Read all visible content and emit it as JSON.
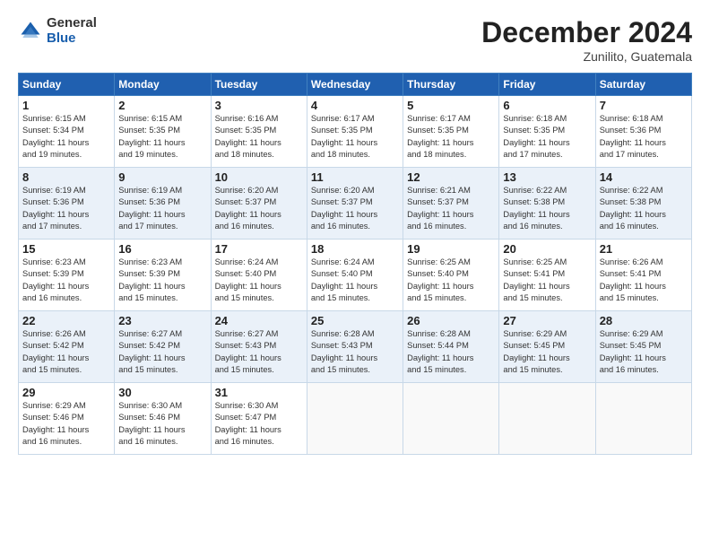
{
  "logo": {
    "general": "General",
    "blue": "Blue"
  },
  "header": {
    "month": "December 2024",
    "location": "Zunilito, Guatemala"
  },
  "weekdays": [
    "Sunday",
    "Monday",
    "Tuesday",
    "Wednesday",
    "Thursday",
    "Friday",
    "Saturday"
  ],
  "weeks": [
    [
      {
        "day": "1",
        "text": "Sunrise: 6:15 AM\nSunset: 5:34 PM\nDaylight: 11 hours\nand 19 minutes."
      },
      {
        "day": "2",
        "text": "Sunrise: 6:15 AM\nSunset: 5:35 PM\nDaylight: 11 hours\nand 19 minutes."
      },
      {
        "day": "3",
        "text": "Sunrise: 6:16 AM\nSunset: 5:35 PM\nDaylight: 11 hours\nand 18 minutes."
      },
      {
        "day": "4",
        "text": "Sunrise: 6:17 AM\nSunset: 5:35 PM\nDaylight: 11 hours\nand 18 minutes."
      },
      {
        "day": "5",
        "text": "Sunrise: 6:17 AM\nSunset: 5:35 PM\nDaylight: 11 hours\nand 18 minutes."
      },
      {
        "day": "6",
        "text": "Sunrise: 6:18 AM\nSunset: 5:35 PM\nDaylight: 11 hours\nand 17 minutes."
      },
      {
        "day": "7",
        "text": "Sunrise: 6:18 AM\nSunset: 5:36 PM\nDaylight: 11 hours\nand 17 minutes."
      }
    ],
    [
      {
        "day": "8",
        "text": "Sunrise: 6:19 AM\nSunset: 5:36 PM\nDaylight: 11 hours\nand 17 minutes."
      },
      {
        "day": "9",
        "text": "Sunrise: 6:19 AM\nSunset: 5:36 PM\nDaylight: 11 hours\nand 17 minutes."
      },
      {
        "day": "10",
        "text": "Sunrise: 6:20 AM\nSunset: 5:37 PM\nDaylight: 11 hours\nand 16 minutes."
      },
      {
        "day": "11",
        "text": "Sunrise: 6:20 AM\nSunset: 5:37 PM\nDaylight: 11 hours\nand 16 minutes."
      },
      {
        "day": "12",
        "text": "Sunrise: 6:21 AM\nSunset: 5:37 PM\nDaylight: 11 hours\nand 16 minutes."
      },
      {
        "day": "13",
        "text": "Sunrise: 6:22 AM\nSunset: 5:38 PM\nDaylight: 11 hours\nand 16 minutes."
      },
      {
        "day": "14",
        "text": "Sunrise: 6:22 AM\nSunset: 5:38 PM\nDaylight: 11 hours\nand 16 minutes."
      }
    ],
    [
      {
        "day": "15",
        "text": "Sunrise: 6:23 AM\nSunset: 5:39 PM\nDaylight: 11 hours\nand 16 minutes."
      },
      {
        "day": "16",
        "text": "Sunrise: 6:23 AM\nSunset: 5:39 PM\nDaylight: 11 hours\nand 15 minutes."
      },
      {
        "day": "17",
        "text": "Sunrise: 6:24 AM\nSunset: 5:40 PM\nDaylight: 11 hours\nand 15 minutes."
      },
      {
        "day": "18",
        "text": "Sunrise: 6:24 AM\nSunset: 5:40 PM\nDaylight: 11 hours\nand 15 minutes."
      },
      {
        "day": "19",
        "text": "Sunrise: 6:25 AM\nSunset: 5:40 PM\nDaylight: 11 hours\nand 15 minutes."
      },
      {
        "day": "20",
        "text": "Sunrise: 6:25 AM\nSunset: 5:41 PM\nDaylight: 11 hours\nand 15 minutes."
      },
      {
        "day": "21",
        "text": "Sunrise: 6:26 AM\nSunset: 5:41 PM\nDaylight: 11 hours\nand 15 minutes."
      }
    ],
    [
      {
        "day": "22",
        "text": "Sunrise: 6:26 AM\nSunset: 5:42 PM\nDaylight: 11 hours\nand 15 minutes."
      },
      {
        "day": "23",
        "text": "Sunrise: 6:27 AM\nSunset: 5:42 PM\nDaylight: 11 hours\nand 15 minutes."
      },
      {
        "day": "24",
        "text": "Sunrise: 6:27 AM\nSunset: 5:43 PM\nDaylight: 11 hours\nand 15 minutes."
      },
      {
        "day": "25",
        "text": "Sunrise: 6:28 AM\nSunset: 5:43 PM\nDaylight: 11 hours\nand 15 minutes."
      },
      {
        "day": "26",
        "text": "Sunrise: 6:28 AM\nSunset: 5:44 PM\nDaylight: 11 hours\nand 15 minutes."
      },
      {
        "day": "27",
        "text": "Sunrise: 6:29 AM\nSunset: 5:45 PM\nDaylight: 11 hours\nand 15 minutes."
      },
      {
        "day": "28",
        "text": "Sunrise: 6:29 AM\nSunset: 5:45 PM\nDaylight: 11 hours\nand 16 minutes."
      }
    ],
    [
      {
        "day": "29",
        "text": "Sunrise: 6:29 AM\nSunset: 5:46 PM\nDaylight: 11 hours\nand 16 minutes."
      },
      {
        "day": "30",
        "text": "Sunrise: 6:30 AM\nSunset: 5:46 PM\nDaylight: 11 hours\nand 16 minutes."
      },
      {
        "day": "31",
        "text": "Sunrise: 6:30 AM\nSunset: 5:47 PM\nDaylight: 11 hours\nand 16 minutes."
      },
      {
        "day": "",
        "text": ""
      },
      {
        "day": "",
        "text": ""
      },
      {
        "day": "",
        "text": ""
      },
      {
        "day": "",
        "text": ""
      }
    ]
  ]
}
